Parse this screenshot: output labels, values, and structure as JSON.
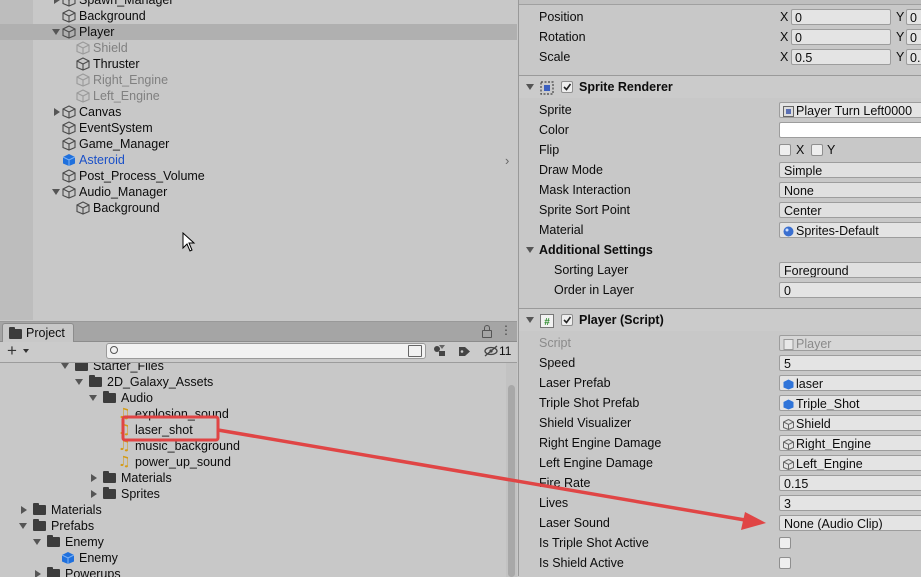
{
  "hierarchy": {
    "items": [
      {
        "label": "Spawn_Manager",
        "depth": 1,
        "fold": "right",
        "style": "normal"
      },
      {
        "label": "Background",
        "depth": 1,
        "fold": "none",
        "style": "normal"
      },
      {
        "label": "Player",
        "depth": 1,
        "fold": "down",
        "style": "normal",
        "selected": true
      },
      {
        "label": "Shield",
        "depth": 2,
        "fold": "none",
        "style": "dim"
      },
      {
        "label": "Thruster",
        "depth": 2,
        "fold": "none",
        "style": "normal"
      },
      {
        "label": "Right_Engine",
        "depth": 2,
        "fold": "none",
        "style": "dim"
      },
      {
        "label": "Left_Engine",
        "depth": 2,
        "fold": "none",
        "style": "dim"
      },
      {
        "label": "Canvas",
        "depth": 1,
        "fold": "right",
        "style": "normal"
      },
      {
        "label": "EventSystem",
        "depth": 1,
        "fold": "none",
        "style": "normal"
      },
      {
        "label": "Game_Manager",
        "depth": 1,
        "fold": "none",
        "style": "normal"
      },
      {
        "label": "Asteroid",
        "depth": 1,
        "fold": "none",
        "style": "prefab"
      },
      {
        "label": "Post_Process_Volume",
        "depth": 1,
        "fold": "none",
        "style": "normal"
      },
      {
        "label": "Audio_Manager",
        "depth": 1,
        "fold": "down",
        "style": "normal"
      },
      {
        "label": "Background",
        "depth": 2,
        "fold": "none",
        "style": "normal"
      }
    ]
  },
  "project": {
    "tab_label": "Project",
    "search": {
      "placeholder": "",
      "value": ""
    },
    "hidden_count": "11",
    "items": [
      {
        "label": "Starter_Files",
        "depth": 4,
        "fold": "down",
        "kind": "folder"
      },
      {
        "label": "2D_Galaxy_Assets",
        "depth": 5,
        "fold": "down",
        "kind": "folder"
      },
      {
        "label": "Audio",
        "depth": 6,
        "fold": "down",
        "kind": "folder"
      },
      {
        "label": "explosion_sound",
        "depth": 7,
        "fold": "none",
        "kind": "audio"
      },
      {
        "label": "laser_shot",
        "depth": 7,
        "fold": "none",
        "kind": "audio",
        "highlighted": true
      },
      {
        "label": "music_background",
        "depth": 7,
        "fold": "none",
        "kind": "audio"
      },
      {
        "label": "power_up_sound",
        "depth": 7,
        "fold": "none",
        "kind": "audio"
      },
      {
        "label": "Materials",
        "depth": 6,
        "fold": "right",
        "kind": "folder"
      },
      {
        "label": "Sprites",
        "depth": 6,
        "fold": "right",
        "kind": "folder"
      },
      {
        "label": "Materials",
        "depth": 1,
        "fold": "right",
        "kind": "folder"
      },
      {
        "label": "Prefabs",
        "depth": 1,
        "fold": "down",
        "kind": "folder"
      },
      {
        "label": "Enemy",
        "depth": 2,
        "fold": "down",
        "kind": "folder"
      },
      {
        "label": "Enemy",
        "depth": 3,
        "fold": "none",
        "kind": "prefab"
      },
      {
        "label": "Powerups",
        "depth": 2,
        "fold": "right",
        "kind": "folder"
      }
    ]
  },
  "inspector": {
    "transform": {
      "position": {
        "label": "Position",
        "x": "0",
        "y": "0"
      },
      "rotation": {
        "label": "Rotation",
        "x": "0",
        "y": "0"
      },
      "scale": {
        "label": "Scale",
        "x": "0.5",
        "y": "0."
      }
    },
    "sprite_renderer": {
      "title": "Sprite Renderer",
      "sprite": {
        "label": "Sprite",
        "value": "Player Turn Left0000"
      },
      "color": {
        "label": "Color"
      },
      "flip": {
        "label": "Flip",
        "x": "X",
        "y": "Y"
      },
      "draw_mode": {
        "label": "Draw Mode",
        "value": "Simple"
      },
      "mask_interaction": {
        "label": "Mask Interaction",
        "value": "None"
      },
      "sprite_sort_point": {
        "label": "Sprite Sort Point",
        "value": "Center"
      },
      "material": {
        "label": "Material",
        "value": "Sprites-Default"
      },
      "additional_settings": "Additional Settings",
      "sorting_layer": {
        "label": "Sorting Layer",
        "value": "Foreground"
      },
      "order_in_layer": {
        "label": "Order in Layer",
        "value": "0"
      }
    },
    "player_script": {
      "title": "Player (Script)",
      "script": {
        "label": "Script",
        "value": "Player"
      },
      "speed": {
        "label": "Speed",
        "value": "5"
      },
      "laser_prefab": {
        "label": "Laser Prefab",
        "value": "laser"
      },
      "triple_shot_prefab": {
        "label": "Triple Shot Prefab",
        "value": "Triple_Shot"
      },
      "shield_visualizer": {
        "label": "Shield Visualizer",
        "value": "Shield"
      },
      "right_engine_damage": {
        "label": "Right Engine Damage",
        "value": "Right_Engine"
      },
      "left_engine_damage": {
        "label": "Left Engine Damage",
        "value": "Left_Engine"
      },
      "fire_rate": {
        "label": "Fire Rate",
        "value": "0.15"
      },
      "lives": {
        "label": "Lives",
        "value": "3"
      },
      "laser_sound": {
        "label": "Laser Sound",
        "value": "None (Audio Clip)"
      },
      "is_triple_shot_active": {
        "label": "Is Triple Shot Active"
      },
      "is_shield_active": {
        "label": "Is Shield Active"
      }
    }
  },
  "colors": {
    "annotation": "#e04545",
    "prefab_blue": "#1a50c8",
    "audio_icon": "#d49b16"
  }
}
